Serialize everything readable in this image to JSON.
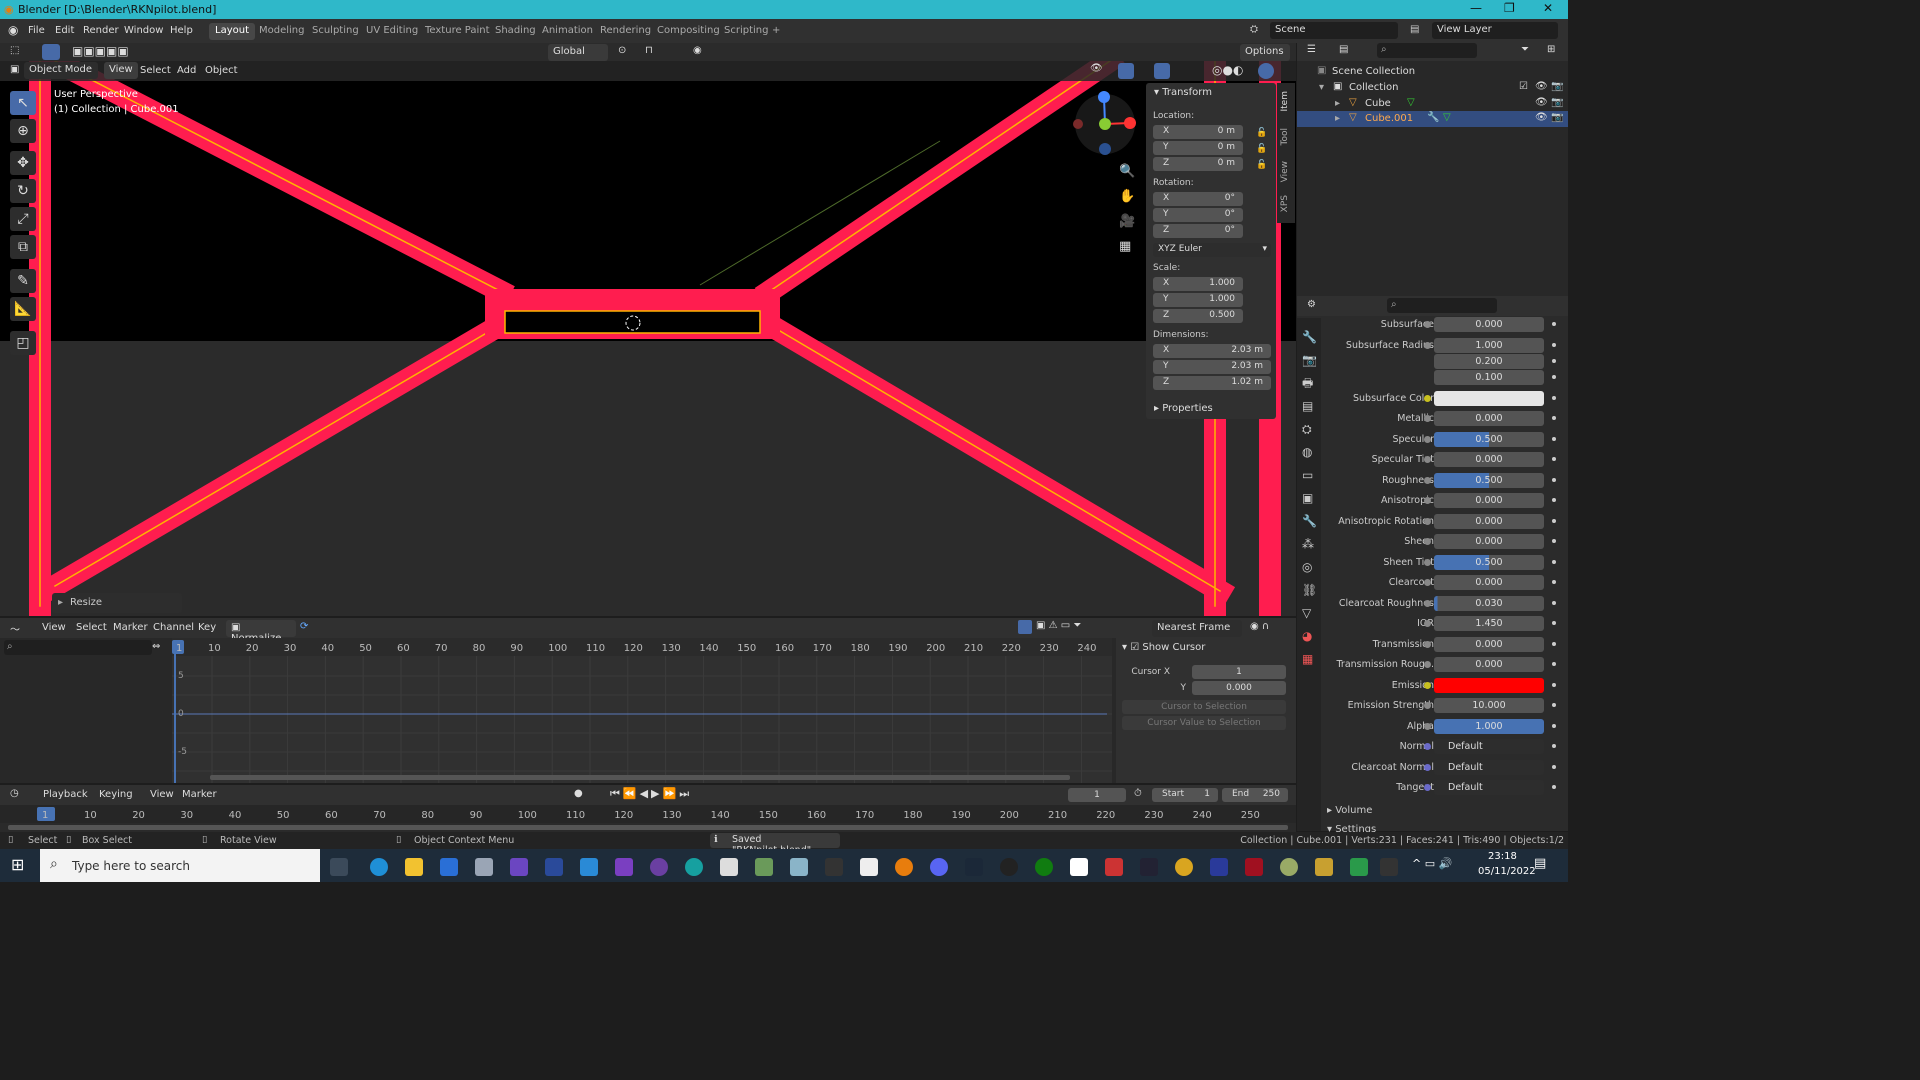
{
  "window": {
    "title": "Blender [D:\\Blender\\RKNpilot.blend]",
    "controls": [
      "—",
      "❐",
      "✕"
    ]
  },
  "menu": [
    "File",
    "Edit",
    "Render",
    "Window",
    "Help"
  ],
  "workspaces": [
    "Layout",
    "Modeling",
    "Sculpting",
    "UV Editing",
    "Texture Paint",
    "Shading",
    "Animation",
    "Rendering",
    "Compositing",
    "Scripting",
    "+"
  ],
  "active_workspace": "Layout",
  "scene": "Scene",
  "view_layer": "View Layer",
  "toolbar": {
    "orientation": "Global",
    "options": "Options"
  },
  "viewport_header": {
    "mode": "Object Mode",
    "menus": [
      "View",
      "Select",
      "Add",
      "Object"
    ]
  },
  "viewport": {
    "line1": "User Perspective",
    "line2": "(1) Collection | Cube.001",
    "last_op": "Resize"
  },
  "transform": {
    "title": "Transform",
    "location_label": "Location:",
    "location": [
      [
        "X",
        "0 m"
      ],
      [
        "Y",
        "0 m"
      ],
      [
        "Z",
        "0 m"
      ]
    ],
    "rotation_label": "Rotation:",
    "rotation": [
      [
        "X",
        "0°"
      ],
      [
        "Y",
        "0°"
      ],
      [
        "Z",
        "0°"
      ]
    ],
    "rotation_mode": "XYZ Euler",
    "scale_label": "Scale:",
    "scale": [
      [
        "X",
        "1.000"
      ],
      [
        "Y",
        "1.000"
      ],
      [
        "Z",
        "0.500"
      ]
    ],
    "dimensions_label": "Dimensions:",
    "dimensions": [
      [
        "X",
        "2.03 m"
      ],
      [
        "Y",
        "2.03 m"
      ],
      [
        "Z",
        "1.02 m"
      ]
    ],
    "properties": "Properties"
  },
  "side_tabs": [
    "Item",
    "Tool",
    "View",
    "XPS"
  ],
  "outliner": {
    "root": "Scene Collection",
    "collection": "Collection",
    "items": [
      "Cube",
      "Cube.001"
    ],
    "selected": "Cube.001"
  },
  "properties": {
    "rows": [
      {
        "label": "Subsurface",
        "value": "0.000"
      },
      {
        "label": "Subsurface Radius",
        "value": "1.000"
      },
      {
        "label": "",
        "value": "0.200"
      },
      {
        "label": "",
        "value": "0.100"
      },
      {
        "label": "Subsurface Color",
        "value": "",
        "color": "#e6e6e6"
      },
      {
        "label": "Metallic",
        "value": "0.000"
      },
      {
        "label": "Specular",
        "value": "0.500",
        "fill": 0.5
      },
      {
        "label": "Specular Tint",
        "value": "0.000"
      },
      {
        "label": "Roughness",
        "value": "0.500",
        "fill": 0.5
      },
      {
        "label": "Anisotropic",
        "value": "0.000"
      },
      {
        "label": "Anisotropic Rotation",
        "value": "0.000"
      },
      {
        "label": "Sheen",
        "value": "0.000"
      },
      {
        "label": "Sheen Tint",
        "value": "0.500",
        "fill": 0.5
      },
      {
        "label": "Clearcoat",
        "value": "0.000"
      },
      {
        "label": "Clearcoat Roughnes",
        "value": "0.030",
        "fill": 0.03
      },
      {
        "label": "IOR",
        "value": "1.450"
      },
      {
        "label": "Transmission",
        "value": "0.000"
      },
      {
        "label": "Transmission Roug...",
        "value": "0.000"
      },
      {
        "label": "Emission",
        "value": "",
        "color": "#ff0000"
      },
      {
        "label": "Emission Strength",
        "value": "10.000"
      },
      {
        "label": "Alpha",
        "value": "1.000",
        "fill": 1.0
      },
      {
        "label": "Normal",
        "value": "Default",
        "link": true
      },
      {
        "label": "Clearcoat Normal",
        "value": "Default",
        "link": true
      },
      {
        "label": "Tangent",
        "value": "Default",
        "link": true
      }
    ],
    "sections": [
      "Volume",
      "Settings"
    ]
  },
  "graph_editor": {
    "menus": [
      "View",
      "Select",
      "Marker",
      "Channel",
      "Key"
    ],
    "normalize": "Normalize",
    "snap": "Nearest Frame",
    "frames": [
      "1",
      "10",
      "20",
      "30",
      "40",
      "50",
      "60",
      "70",
      "80",
      "90",
      "100",
      "110",
      "120",
      "130",
      "140",
      "150",
      "160",
      "170",
      "180",
      "190",
      "200",
      "210",
      "220",
      "230",
      "240"
    ],
    "y_ticks": [
      "5",
      "0",
      "-5"
    ],
    "show_cursor": "Show Cursor",
    "cursor_x_label": "Cursor X",
    "cursor_x": "1",
    "cursor_y_label": "Y",
    "cursor_y": "0.000",
    "cursor_to_selection": "Cursor to Selection",
    "cursor_value_to_selection": "Cursor Value to Selection"
  },
  "timeline": {
    "menus": [
      "Playback",
      "Keying",
      "View",
      "Marker"
    ],
    "current": "1",
    "start_label": "Start",
    "start": "1",
    "end_label": "End",
    "end": "250",
    "frames": [
      "1",
      "10",
      "20",
      "30",
      "40",
      "50",
      "60",
      "70",
      "80",
      "90",
      "100",
      "110",
      "120",
      "130",
      "140",
      "150",
      "160",
      "170",
      "180",
      "190",
      "200",
      "210",
      "220",
      "230",
      "240",
      "250"
    ]
  },
  "status": {
    "select": "Select",
    "box_select": "Box Select",
    "rotate_view": "Rotate View",
    "context_menu": "Object Context Menu",
    "saved": "Saved \"RKNpilot.blend\"",
    "stats": "Collection | Cube.001 | Verts:231 | Faces:241 | Tris:490 | Objects:1/2"
  },
  "taskbar": {
    "search_placeholder": "Type here to search",
    "time": "23:18",
    "date": "05/11/2022"
  }
}
